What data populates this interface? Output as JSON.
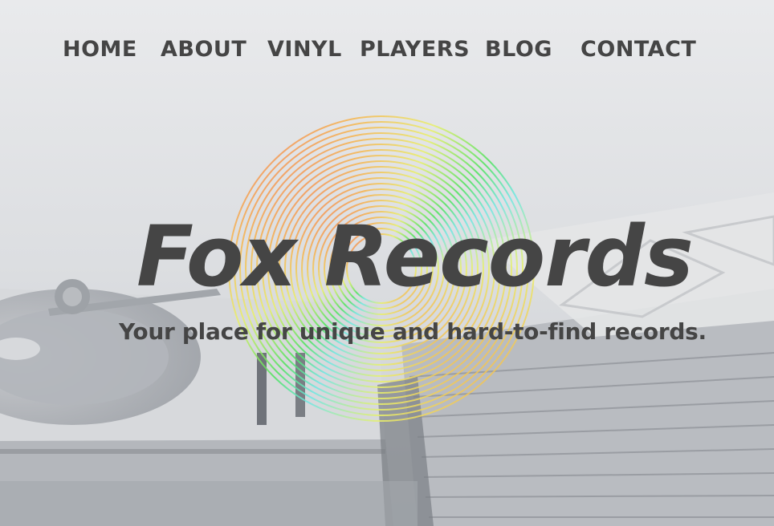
{
  "nav": {
    "items": [
      {
        "label": "HOME"
      },
      {
        "label": "ABOUT"
      },
      {
        "label": "VINYL"
      },
      {
        "label": "PLAYERS"
      },
      {
        "label": "BLOG"
      },
      {
        "label": "CONTACT"
      }
    ]
  },
  "hero": {
    "title": "Fox Records",
    "tagline": "Your place for unique and hard-to-find records."
  },
  "colors": {
    "text": "#454545",
    "background": "#e6e7e9",
    "ring_red": "#f0595e",
    "ring_orange": "#f6b24e",
    "ring_yellow": "#e9f06a",
    "ring_green": "#4ce35a",
    "ring_cyan": "#6fe7e4"
  },
  "icons": {
    "hero_graphic": "vinyl-record-rings-icon",
    "background_image": "turntable-and-records-photo"
  }
}
